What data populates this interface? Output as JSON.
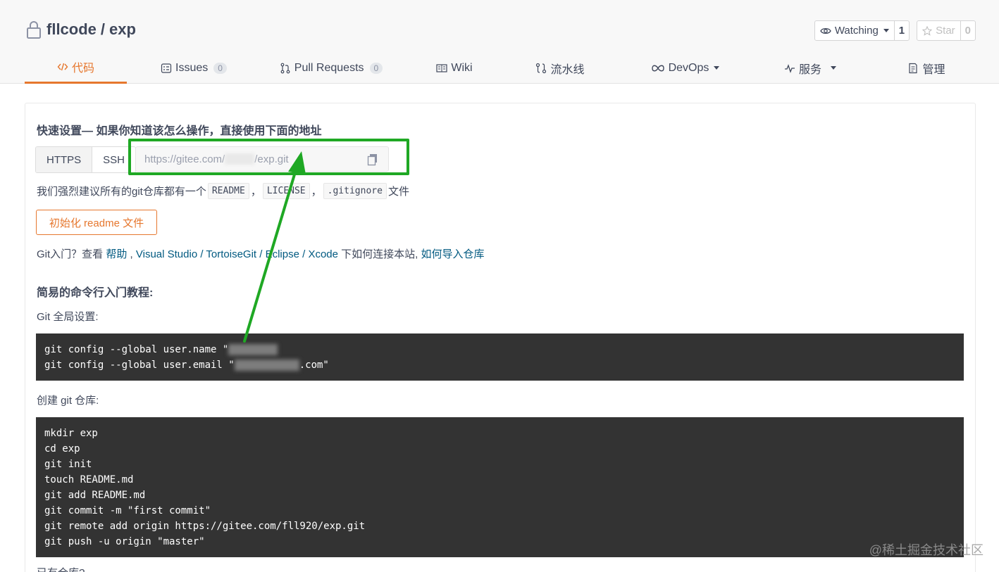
{
  "repo": {
    "owner": "fllcode",
    "separator": "/",
    "name": "exp"
  },
  "actions": {
    "watching_label": "Watching",
    "watching_count": "1",
    "star_label": "Star",
    "star_count": "0"
  },
  "tabs": [
    {
      "label": "代码",
      "icon": "code-icon",
      "active": true
    },
    {
      "label": "Issues",
      "count": "0",
      "icon": "issues-icon"
    },
    {
      "label": "Pull Requests",
      "count": "0",
      "icon": "pull-request-icon"
    },
    {
      "label": "Wiki",
      "icon": "wiki-icon"
    },
    {
      "label": "流水线",
      "icon": "pipeline-icon"
    },
    {
      "label": "DevOps",
      "icon": "infinity-icon",
      "dropdown": true
    },
    {
      "label": "服务",
      "icon": "pulse-icon",
      "dropdown": true
    },
    {
      "label": "管理",
      "icon": "manage-icon"
    }
  ],
  "quick_setup": {
    "title": "快速设置— 如果你知道该怎么操作，直接使用下面的地址",
    "protocols": [
      "HTTPS",
      "SSH"
    ],
    "url_prefix": "https://gitee.com/",
    "url_suffix": "/exp.git"
  },
  "recommend": {
    "prefix": "我们强烈建议所有的git仓库都有一个",
    "files": [
      "README",
      "LICENSE",
      ".gitignore"
    ],
    "sep": "，",
    "suffix": "文件"
  },
  "init_button": "初始化 readme 文件",
  "help": {
    "prefix": "Git入门？查看 ",
    "link_help": "帮助",
    "sep1": " , ",
    "link_tools": "Visual Studio / TortoiseGit / Eclipse / Xcode",
    "middle": " 下如何连接本站, ",
    "link_import": "如何导入仓库"
  },
  "tutorial": {
    "title": "简易的命令行入门教程:",
    "global_label": "Git 全局设置:",
    "global_line1": "git config --global user.name \"",
    "global_line2_prefix": "git config --global user.email \"",
    "global_line2_suffix": ".com\"",
    "create_label": "创建 git 仓库:",
    "create_lines": [
      "mkdir exp",
      "cd exp",
      "git init",
      "touch README.md",
      "git add README.md",
      "git commit -m \"first commit\"",
      "git remote add origin https://gitee.com/fll920/exp.git",
      "git push -u origin \"master\""
    ],
    "existing_label": "已有仓库?"
  },
  "watermark": "@稀土掘金技术社区",
  "colors": {
    "accent": "#e6772e",
    "link": "#005980",
    "highlight": "#1fa824",
    "code_bg": "#333333"
  }
}
